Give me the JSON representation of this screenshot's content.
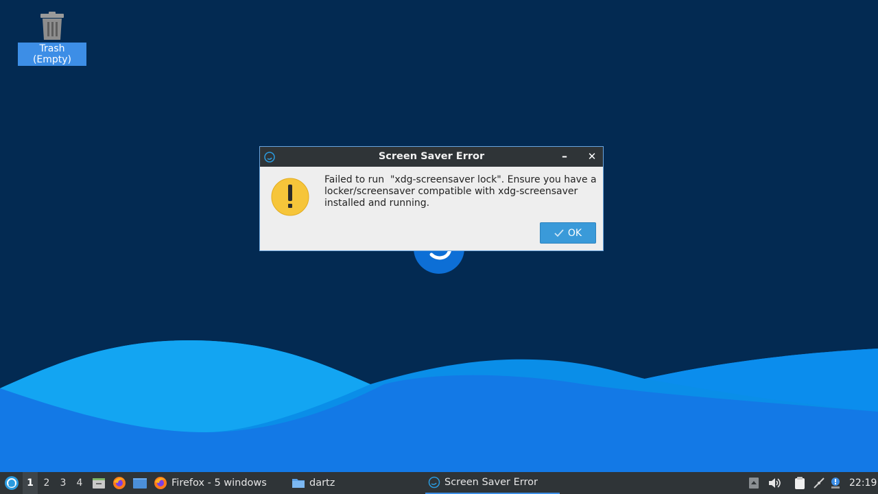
{
  "desktop": {
    "trash_label": "Trash (Empty)"
  },
  "dialog": {
    "title": "Screen Saver Error",
    "minimize_label": "–",
    "close_label": "✕",
    "message_line1": "Failed to run  \"xdg-screensaver lock\". Ensure you have a",
    "message_line2": "locker/screensaver compatible with xdg-screensaver",
    "message_line3": "installed and running.",
    "ok_label": "OK"
  },
  "taskbar": {
    "desktops": [
      "1",
      "2",
      "3",
      "4"
    ],
    "active_desktop": "1",
    "tasks": [
      {
        "label": "Firefox - 5 windows",
        "icon": "firefox-icon"
      },
      {
        "label": "dartz",
        "icon": "folder-icon"
      },
      {
        "label": "Screen Saver Error",
        "icon": "lubuntu-icon"
      }
    ],
    "clock": "22:19"
  },
  "colors": {
    "desktop_bg": "#032a52",
    "wave_light": "#0aa0f0",
    "wave_mid": "#1480e8",
    "taskbar_bg": "#2f3437",
    "dialog_titlebar": "#2f3437",
    "ok_button": "#3a9ad9",
    "warning": "#f6c53a"
  }
}
